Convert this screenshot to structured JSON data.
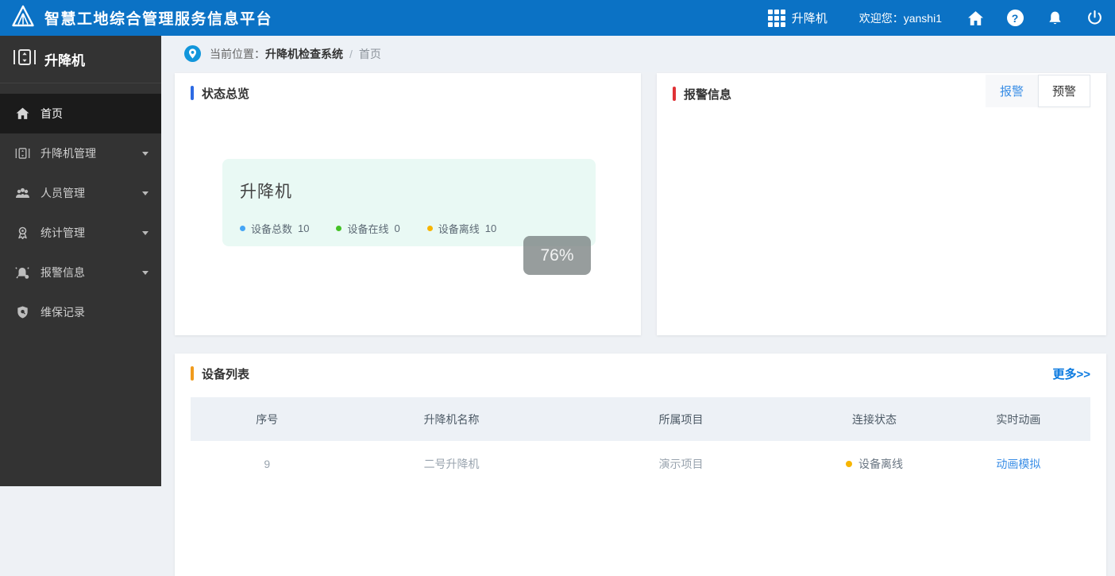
{
  "header": {
    "title": "智慧工地综合管理服务信息平台",
    "app_switcher": "升降机",
    "welcome": "欢迎您：",
    "username": "yanshi1"
  },
  "sidebar": {
    "title": "升降机",
    "items": [
      {
        "id": "home",
        "label": "首页",
        "icon": "home-icon",
        "active": true,
        "has_children": false
      },
      {
        "id": "lift-management",
        "label": "升降机管理",
        "icon": "lift-icon",
        "active": false,
        "has_children": true
      },
      {
        "id": "personnel-management",
        "label": "人员管理",
        "icon": "people-icon",
        "active": false,
        "has_children": true
      },
      {
        "id": "statistics-management",
        "label": "统计管理",
        "icon": "medal-icon",
        "active": false,
        "has_children": true
      },
      {
        "id": "alarm-info",
        "label": "报警信息",
        "icon": "alarm-icon",
        "active": false,
        "has_children": true
      },
      {
        "id": "maintenance-records",
        "label": "维保记录",
        "icon": "shield-icon",
        "active": false,
        "has_children": false
      }
    ]
  },
  "breadcrumb": {
    "prefix": "当前位置：",
    "system": "升降机检查系统",
    "separator": "/",
    "current": "首页"
  },
  "status_panel": {
    "title": "状态总览",
    "accent_color": "#2d6ae3",
    "card": {
      "title": "升降机",
      "stats": [
        {
          "label": "设备总数",
          "value": "10",
          "color": "#45a5f5"
        },
        {
          "label": "设备在线",
          "value": "0",
          "color": "#44c226"
        },
        {
          "label": "设备离线",
          "value": "10",
          "color": "#f7b500"
        }
      ]
    }
  },
  "zoom_indicator": "76%",
  "alarm_panel": {
    "title": "报警信息",
    "accent_color": "#e03236",
    "tabs": [
      {
        "label": "报警",
        "active": true
      },
      {
        "label": "预警",
        "active": false
      }
    ]
  },
  "device_panel": {
    "title": "设备列表",
    "accent_color": "#f09b1d",
    "more_label": "更多>>",
    "table": {
      "columns": [
        "序号",
        "升降机名称",
        "所属项目",
        "连接状态",
        "实时动画"
      ],
      "rows": [
        {
          "no": "9",
          "name": "二号升降机",
          "project": "演示项目",
          "status": "设备离线",
          "status_color": "#f7b500",
          "action": "动画模拟"
        }
      ]
    }
  },
  "colors": {
    "header_blue": "#0b72c5",
    "sidebar_dark": "#333333",
    "sidebar_active": "#1b1b1b",
    "card_teal": "#e9f9f4",
    "link_blue": "#3a8ee6"
  }
}
